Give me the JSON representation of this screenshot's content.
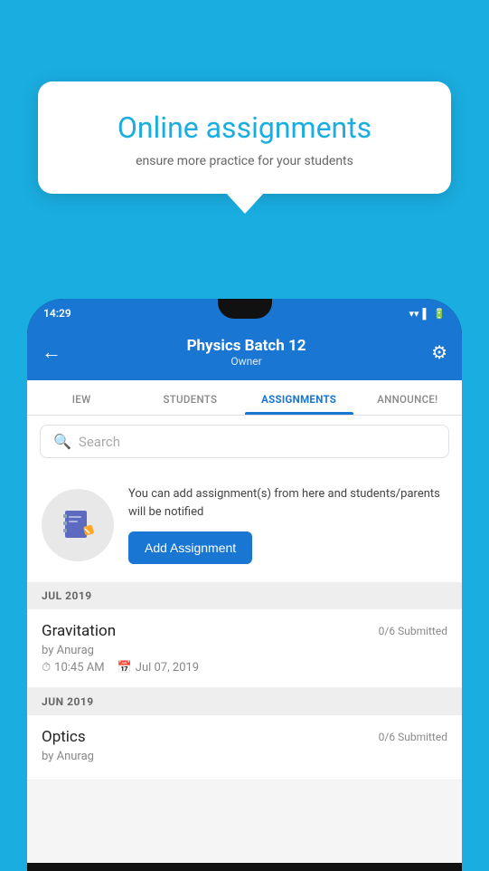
{
  "background_color": "#1AADDF",
  "bubble": {
    "title": "Online assignments",
    "subtitle": "ensure more practice for your students"
  },
  "status_bar": {
    "time": "14:29",
    "icons": [
      "wifi",
      "signal",
      "battery"
    ]
  },
  "app_bar": {
    "title": "Physics Batch 12",
    "subtitle": "Owner",
    "back_label": "←",
    "settings_label": "⚙"
  },
  "tabs": [
    {
      "label": "IEW",
      "active": false
    },
    {
      "label": "STUDENTS",
      "active": false
    },
    {
      "label": "ASSIGNMENTS",
      "active": true
    },
    {
      "label": "ANNOUNCE!",
      "active": false
    }
  ],
  "search": {
    "placeholder": "Search"
  },
  "promo": {
    "text": "You can add assignment(s) from here and students/parents will be notified",
    "button_label": "Add Assignment"
  },
  "sections": [
    {
      "header": "JUL 2019",
      "assignments": [
        {
          "name": "Gravitation",
          "status": "0/6 Submitted",
          "by": "by Anurag",
          "time": "10:45 AM",
          "date": "Jul 07, 2019"
        }
      ]
    },
    {
      "header": "JUN 2019",
      "assignments": [
        {
          "name": "Optics",
          "status": "0/6 Submitted",
          "by": "by Anurag",
          "time": "",
          "date": ""
        }
      ]
    }
  ]
}
